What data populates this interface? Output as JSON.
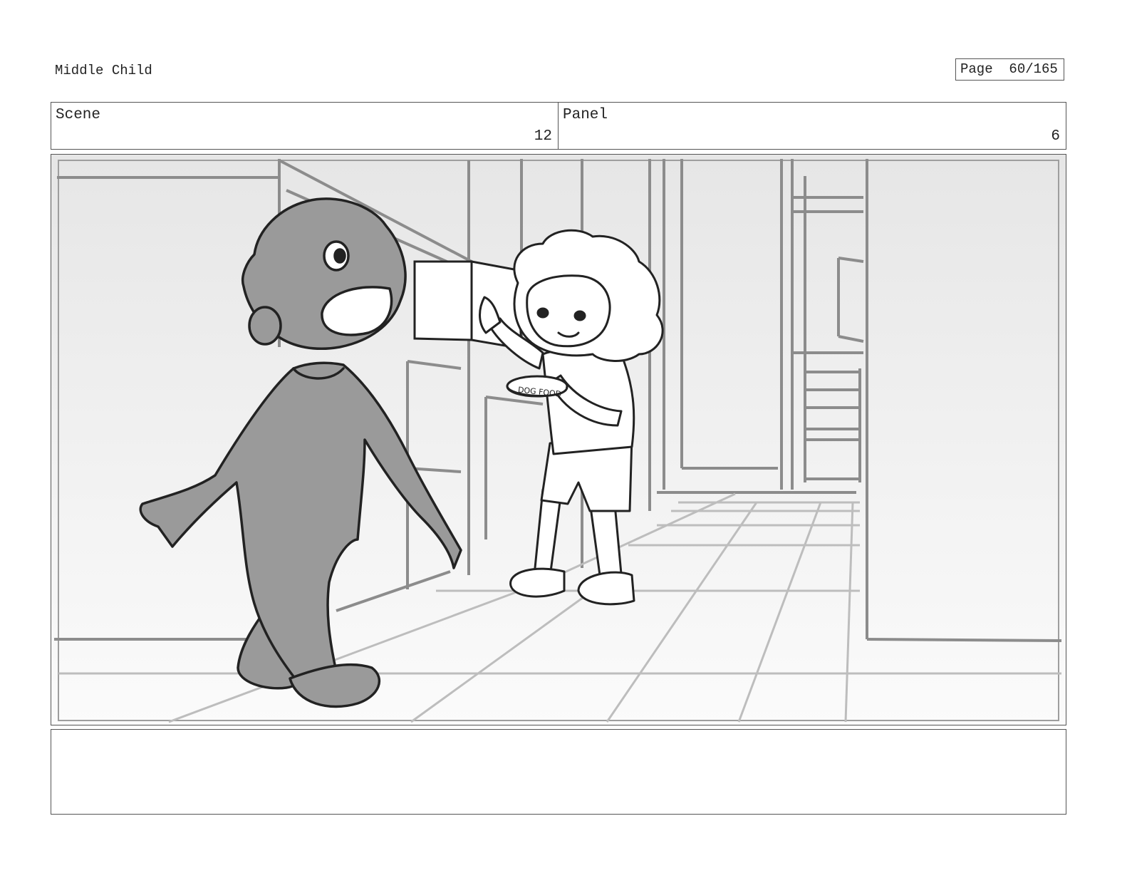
{
  "header": {
    "title": "Middle Child",
    "page_label": "Page",
    "page_number": "60/165"
  },
  "scene": {
    "label": "Scene",
    "value": "12"
  },
  "panel": {
    "label": "Panel",
    "value": "6"
  },
  "drawing": {
    "bowl_text": "DOG FOOD",
    "colors": {
      "line": "#222222",
      "boy_fill": "#9a9a9a",
      "set_lines": "#8c8c8c",
      "floor_lines": "#bdbdbd"
    }
  },
  "notes": {
    "text": ""
  }
}
